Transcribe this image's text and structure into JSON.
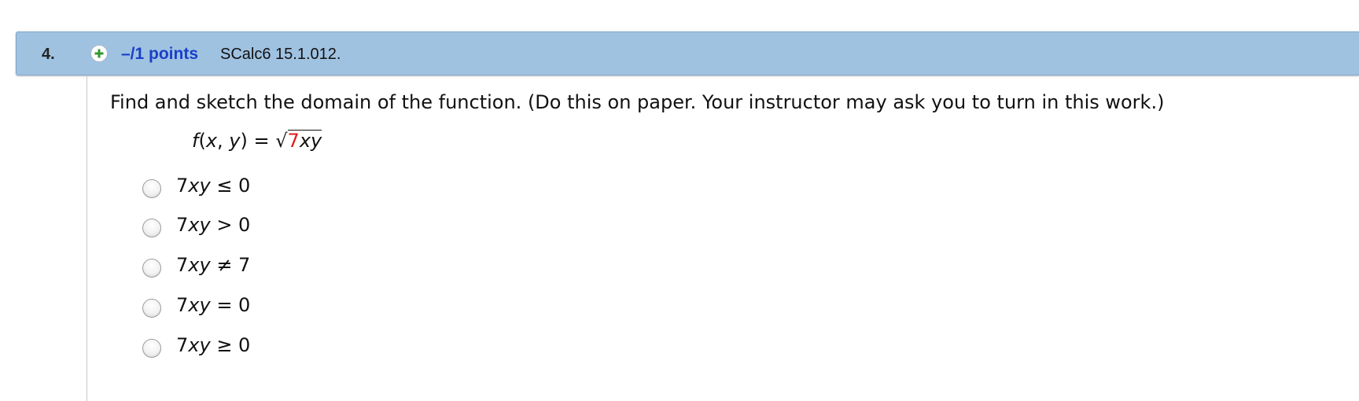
{
  "question": {
    "number": "4.",
    "points": "–/1 points",
    "source": "SCalc6 15.1.012.",
    "prompt": "Find and sketch the domain of the function. (Do this on paper. Your instructor may ask you to turn in this work.)",
    "formula": {
      "lhs_f": "f",
      "lhs_args": "(",
      "x": "x",
      "comma": ", ",
      "y": "y",
      "close_eq": ") = ",
      "sqrt_symbol": "√",
      "radicand_coef": "7",
      "radicand_vars": "xy"
    },
    "options": [
      {
        "coef": "7",
        "vars": "xy",
        "relation": " ≤ 0"
      },
      {
        "coef": "7",
        "vars": "xy",
        "relation": " > 0"
      },
      {
        "coef": "7",
        "vars": "xy",
        "relation": " ≠ 7"
      },
      {
        "coef": "7",
        "vars": "xy",
        "relation": " = 0"
      },
      {
        "coef": "7",
        "vars": "xy",
        "relation": " ≥ 0"
      }
    ]
  },
  "colors": {
    "header_bg": "#9fc2e1",
    "points_link": "#1a3fc8",
    "highlight_red": "#e01b1b",
    "plus_icon_green": "#2f9a2f"
  },
  "icons": {
    "expand": "plus-circle-icon"
  }
}
